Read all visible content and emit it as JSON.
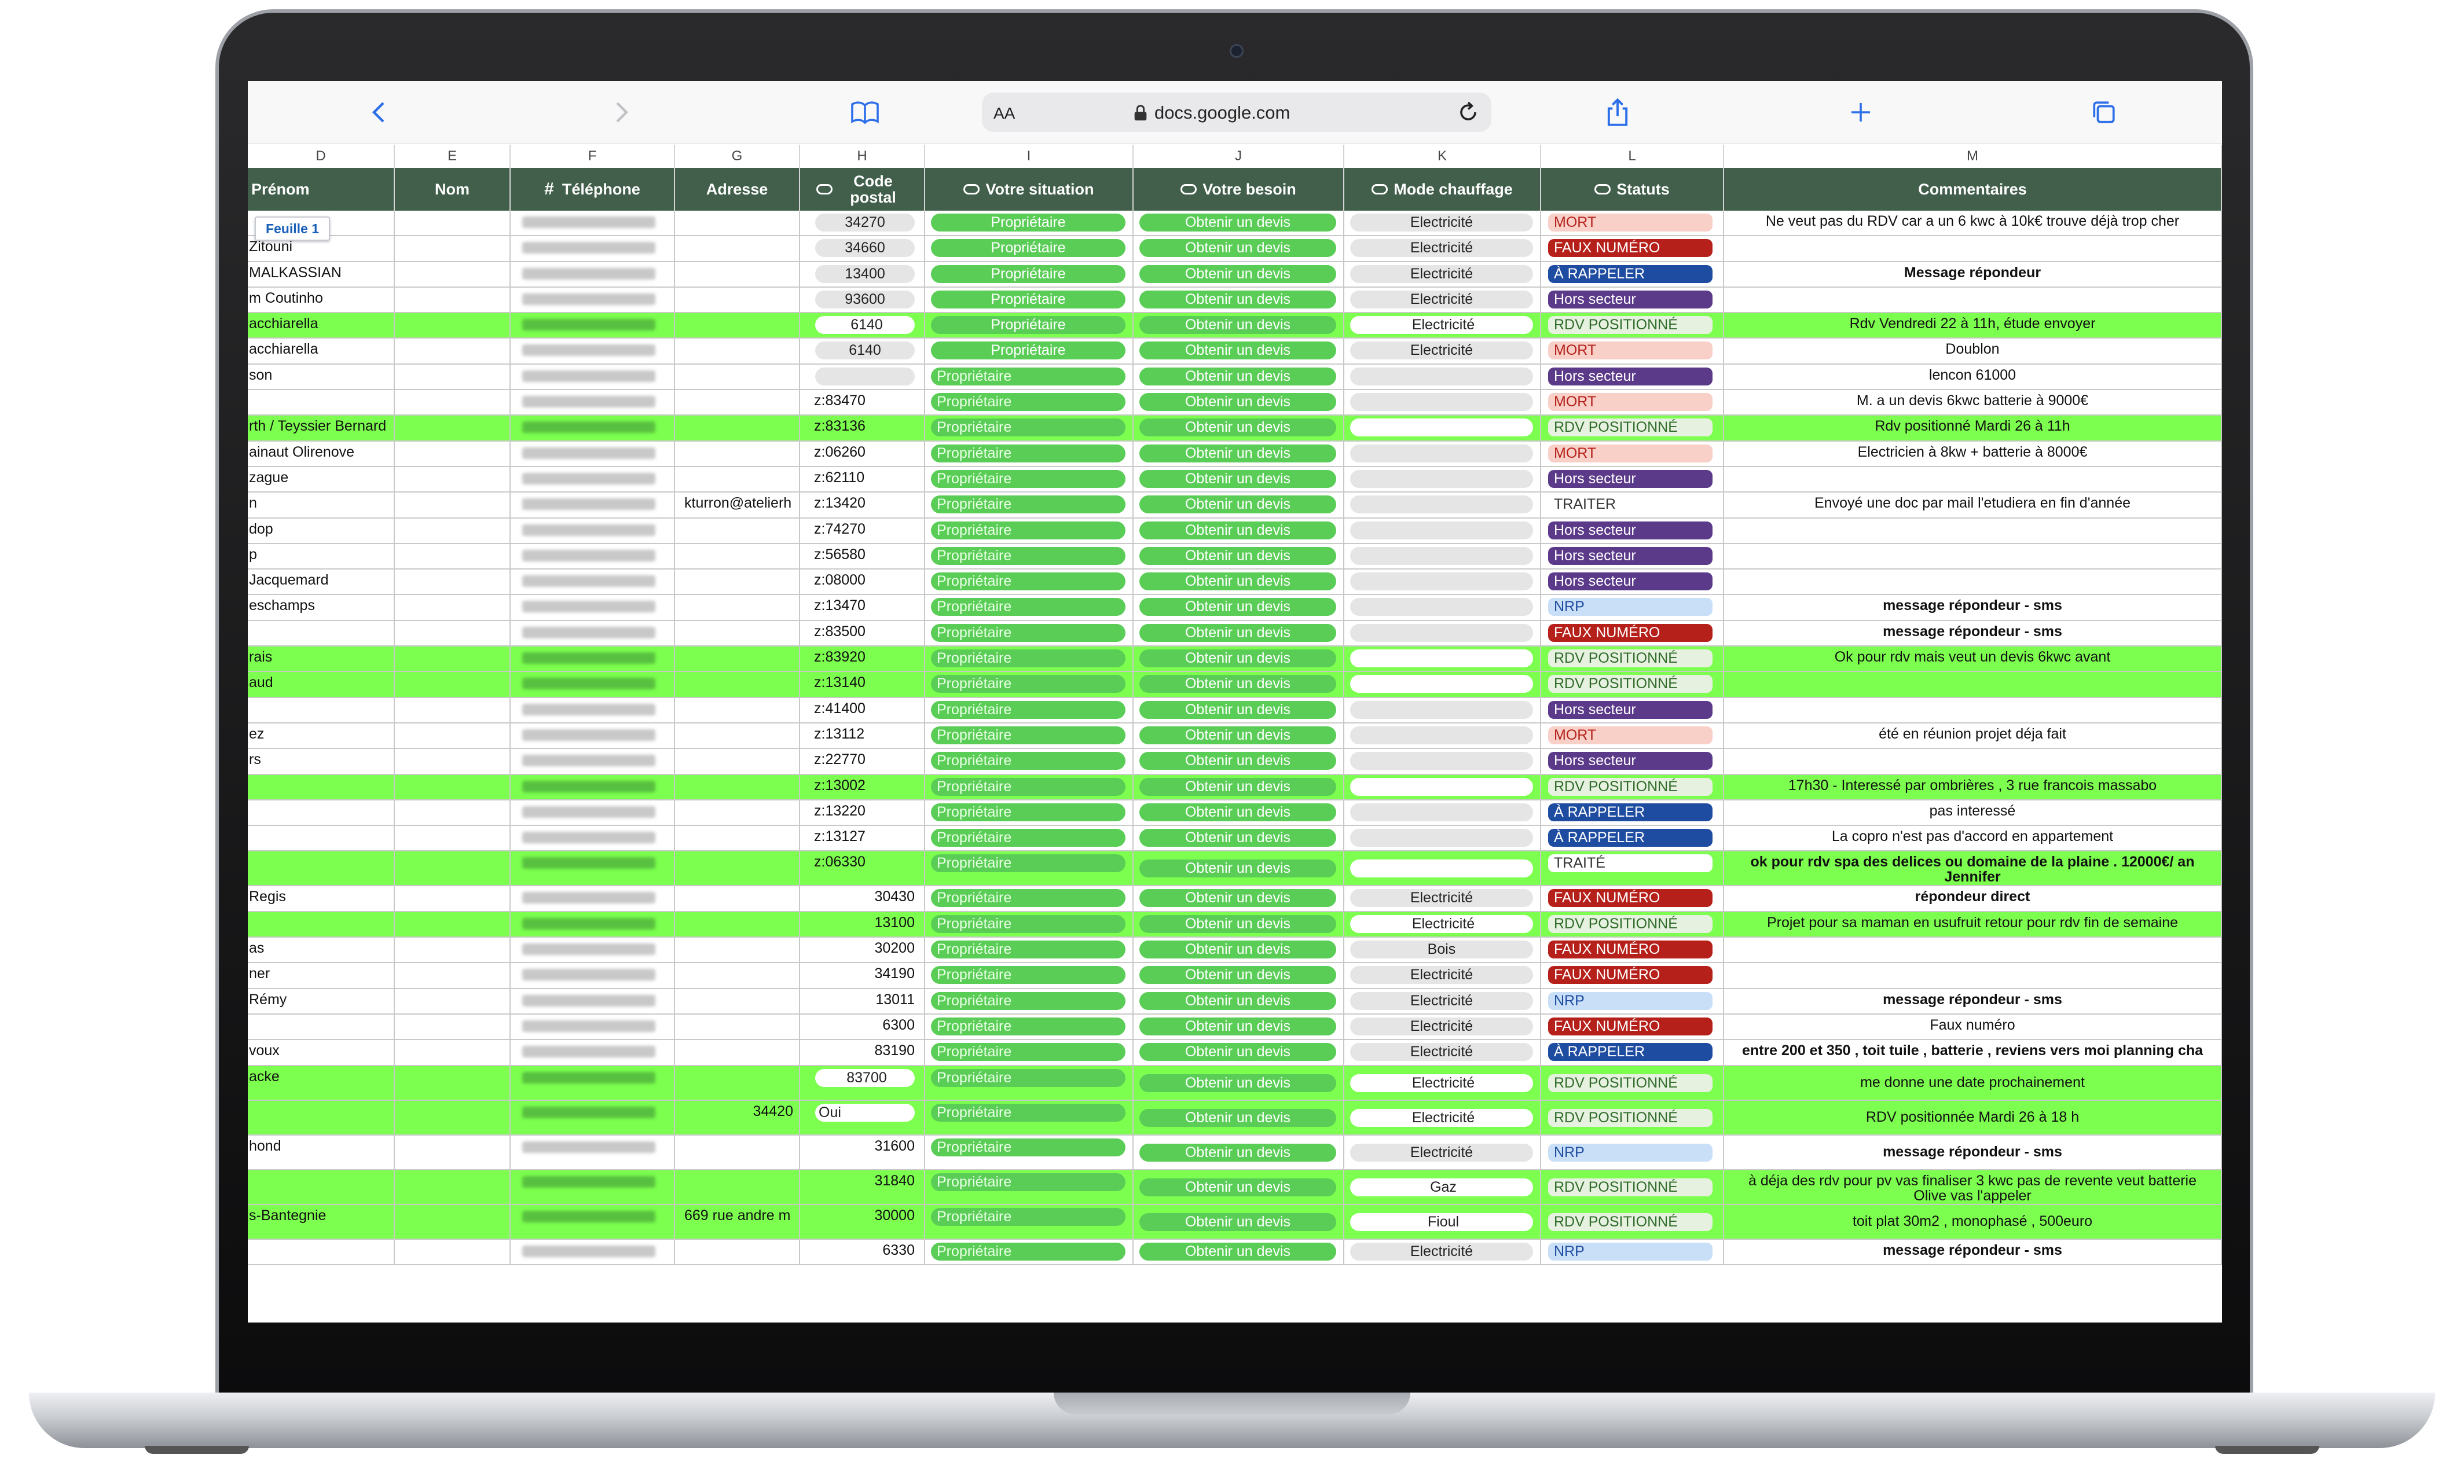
{
  "browser": {
    "text_size": "AA",
    "url": "docs.google.com"
  },
  "column_letters": [
    "D",
    "E",
    "F",
    "G",
    "H",
    "I",
    "J",
    "K",
    "L",
    "M"
  ],
  "headers": [
    "Prénom",
    "Nom",
    "Téléphone",
    "Adresse",
    "Code postal",
    "Votre situation",
    "Votre besoin",
    "Mode chauffage",
    "Statuts",
    "Commentaires"
  ],
  "sheet_tab": "Feuille 1",
  "colors": {
    "header_bg": "#415f4a",
    "row_highlight": "#7cff4e",
    "mort": "#f8d0c8",
    "faux": "#b5201a",
    "rappeler": "#1e4ca0",
    "hors": "#5c3a8a",
    "rdv": "#e6f1df",
    "nrp": "#c9dff7"
  },
  "rows": [
    {
      "prenom": "",
      "adresse": "",
      "cp": "34270",
      "cp_style": "gray",
      "sit": "Propriétaire",
      "sit_style": "light",
      "besoin": "Obtenir un devis",
      "chauff": "Electricité",
      "statut": "MORT",
      "comment": "Ne veut pas du RDV car a un 6 kwc à 10k€ trouve déjà trop cher",
      "bold": false,
      "green": false,
      "h": 2
    },
    {
      "prenom": "Zitouni",
      "adresse": "",
      "cp": "34660",
      "cp_style": "gray",
      "sit": "Propriétaire",
      "sit_style": "light",
      "besoin": "Obtenir un devis",
      "chauff": "Electricité",
      "statut": "FAUX NUMÉRO",
      "comment": "",
      "bold": false,
      "green": false,
      "h": 2
    },
    {
      "prenom": "MALKASSIAN",
      "adresse": "",
      "cp": "13400",
      "cp_style": "gray",
      "sit": "Propriétaire",
      "sit_style": "light",
      "besoin": "Obtenir un devis",
      "chauff": "Electricité",
      "statut": "À RAPPELER",
      "comment": "Message répondeur",
      "bold": true,
      "green": false,
      "h": 2
    },
    {
      "prenom": "m Coutinho",
      "adresse": "",
      "cp": "93600",
      "cp_style": "gray",
      "sit": "Propriétaire",
      "sit_style": "light",
      "besoin": "Obtenir un devis",
      "chauff": "Electricité",
      "statut": "Hors secteur",
      "comment": "",
      "bold": false,
      "green": false,
      "h": 2
    },
    {
      "prenom": "acchiarella",
      "adresse": "",
      "cp": "6140",
      "cp_style": "white",
      "sit": "Propriétaire",
      "sit_style": "light",
      "besoin": "Obtenir un devis",
      "chauff": "Electricité",
      "statut": "RDV POSITIONNÉ",
      "comment": "Rdv Vendredi 22 à 11h, étude envoyer",
      "bold": false,
      "green": true,
      "h": 2
    },
    {
      "prenom": "acchiarella",
      "adresse": "",
      "cp": "6140",
      "cp_style": "gray",
      "sit": "Propriétaire",
      "sit_style": "light",
      "besoin": "Obtenir un devis",
      "chauff": "Electricité",
      "statut": "MORT",
      "comment": "Doublon",
      "bold": false,
      "green": false,
      "h": 2
    },
    {
      "prenom": "son",
      "adresse": "",
      "cp": "",
      "cp_style": "gray",
      "sit": "Propriétaire",
      "sit_style": "left",
      "besoin": "Obtenir un devis",
      "chauff": "",
      "statut": "Hors secteur",
      "comment": "lencon 61000",
      "bold": false,
      "green": false,
      "h": 2
    },
    {
      "prenom": "",
      "adresse": "",
      "cp": "z:83470",
      "cp_style": "text",
      "sit": "Propriétaire",
      "sit_style": "left",
      "besoin": "Obtenir un devis",
      "chauff": "",
      "statut": "MORT",
      "comment": "M. a un devis 6kwc batterie à 9000€",
      "bold": false,
      "green": false,
      "h": 2
    },
    {
      "prenom": "rth / Teyssier Bernard",
      "adresse": "",
      "cp": "z:83136",
      "cp_style": "text",
      "sit": "Propriétaire",
      "sit_style": "left",
      "besoin": "Obtenir un devis",
      "chauff": "",
      "statut": "RDV POSITIONNÉ",
      "comment": "Rdv positionné Mardi 26 à 11h",
      "bold": false,
      "green": true,
      "h": 2
    },
    {
      "prenom": "ainaut Olirenove",
      "adresse": "",
      "cp": "z:06260",
      "cp_style": "text",
      "sit": "Propriétaire",
      "sit_style": "left",
      "besoin": "Obtenir un devis",
      "chauff": "",
      "statut": "MORT",
      "comment": "Electricien à 8kw + batterie à 8000€",
      "bold": false,
      "green": false,
      "h": 2
    },
    {
      "prenom": "zague",
      "adresse": "",
      "cp": "z:62110",
      "cp_style": "text",
      "sit": "Propriétaire",
      "sit_style": "left",
      "besoin": "Obtenir un devis",
      "chauff": "",
      "statut": "Hors secteur",
      "comment": "",
      "bold": false,
      "green": false,
      "h": 2
    },
    {
      "prenom": "n",
      "adresse": "kturron@atelierh",
      "cp": "z:13420",
      "cp_style": "text",
      "sit": "Propriétaire",
      "sit_style": "left",
      "besoin": "Obtenir un devis",
      "chauff": "",
      "statut": "TRAITER",
      "comment": "Envoyé une doc par mail l'etudiera en fin d'année",
      "bold": false,
      "green": false,
      "h": 2
    },
    {
      "prenom": "dop",
      "adresse": "",
      "cp": "z:74270",
      "cp_style": "text",
      "sit": "Propriétaire",
      "sit_style": "left",
      "besoin": "Obtenir un devis",
      "chauff": "",
      "statut": "Hors secteur",
      "comment": "",
      "bold": false,
      "green": false,
      "h": 2
    },
    {
      "prenom": "p",
      "adresse": "",
      "cp": "z:56580",
      "cp_style": "text",
      "sit": "Propriétaire",
      "sit_style": "left",
      "besoin": "Obtenir un devis",
      "chauff": "",
      "statut": "Hors secteur",
      "comment": "",
      "bold": false,
      "green": false,
      "h": 2
    },
    {
      "prenom": "Jacquemard",
      "adresse": "",
      "cp": "z:08000",
      "cp_style": "text",
      "sit": "Propriétaire",
      "sit_style": "left",
      "besoin": "Obtenir un devis",
      "chauff": "",
      "statut": "Hors secteur",
      "comment": "",
      "bold": false,
      "green": false,
      "h": 2
    },
    {
      "prenom": "eschamps",
      "adresse": "",
      "cp": "z:13470",
      "cp_style": "text",
      "sit": "Propriétaire",
      "sit_style": "left",
      "besoin": "Obtenir un devis",
      "chauff": "",
      "statut": "NRP",
      "comment": "message répondeur - sms",
      "bold": true,
      "green": false,
      "h": 2
    },
    {
      "prenom": "",
      "adresse": "",
      "cp": "z:83500",
      "cp_style": "text",
      "sit": "Propriétaire",
      "sit_style": "left",
      "besoin": "Obtenir un devis",
      "chauff": "",
      "statut": "FAUX NUMÉRO",
      "comment": "message répondeur - sms",
      "bold": true,
      "green": false,
      "h": 2
    },
    {
      "prenom": "rais",
      "adresse": "",
      "cp": "z:83920",
      "cp_style": "text",
      "sit": "Propriétaire",
      "sit_style": "left",
      "besoin": "Obtenir un devis",
      "chauff": "",
      "statut": "RDV POSITIONNÉ",
      "comment": "Ok pour rdv mais veut un devis 6kwc avant",
      "bold": false,
      "green": true,
      "h": 2
    },
    {
      "prenom": "aud",
      "adresse": "",
      "cp": "z:13140",
      "cp_style": "text",
      "sit": "Propriétaire",
      "sit_style": "left",
      "besoin": "Obtenir un devis",
      "chauff": "",
      "statut": "RDV POSITIONNÉ",
      "comment": "",
      "bold": false,
      "green": true,
      "h": 2
    },
    {
      "prenom": "",
      "adresse": "",
      "cp": "z:41400",
      "cp_style": "text",
      "sit": "Propriétaire",
      "sit_style": "left",
      "besoin": "Obtenir un devis",
      "chauff": "",
      "statut": "Hors secteur",
      "comment": "",
      "bold": false,
      "green": false,
      "h": 2
    },
    {
      "prenom": "ez",
      "adresse": "",
      "cp": "z:13112",
      "cp_style": "text",
      "sit": "Propriétaire",
      "sit_style": "left",
      "besoin": "Obtenir un devis",
      "chauff": "",
      "statut": "MORT",
      "comment": "été en réunion projet déja fait",
      "bold": false,
      "green": false,
      "h": 2
    },
    {
      "prenom": "rs",
      "adresse": "",
      "cp": "z:22770",
      "cp_style": "text",
      "sit": "Propriétaire",
      "sit_style": "left",
      "besoin": "Obtenir un devis",
      "chauff": "",
      "statut": "Hors secteur",
      "comment": "",
      "bold": false,
      "green": false,
      "h": 2
    },
    {
      "prenom": "",
      "adresse": "",
      "cp": "z:13002",
      "cp_style": "text",
      "sit": "Propriétaire",
      "sit_style": "left",
      "besoin": "Obtenir un devis",
      "chauff": "",
      "statut": "RDV POSITIONNÉ",
      "comment": "17h30 - Interessé par ombrières , 3 rue francois massabo",
      "bold": false,
      "green": true,
      "h": 2
    },
    {
      "prenom": "",
      "adresse": "",
      "cp": "z:13220",
      "cp_style": "text",
      "sit": "Propriétaire",
      "sit_style": "left",
      "besoin": "Obtenir un devis",
      "chauff": "",
      "statut": "À RAPPELER",
      "comment": "pas interessé",
      "bold": false,
      "green": false,
      "h": 2
    },
    {
      "prenom": "",
      "adresse": "",
      "cp": "z:13127",
      "cp_style": "text",
      "sit": "Propriétaire",
      "sit_style": "left",
      "besoin": "Obtenir un devis",
      "chauff": "",
      "statut": "À RAPPELER",
      "comment": "La copro n'est pas d'accord en appartement",
      "bold": false,
      "green": false,
      "h": 2
    },
    {
      "prenom": "",
      "adresse": "",
      "cp": "z:06330",
      "cp_style": "text",
      "sit": "Propriétaire",
      "sit_style": "left",
      "besoin": "Obtenir un devis",
      "chauff": "",
      "statut": "TRAITÉ",
      "comment": "ok pour rdv spa des delices ou domaine de la plaine . 12000€/ an",
      "comment2": "Jennifer",
      "bold": true,
      "green": true,
      "h": 3
    },
    {
      "prenom": "Regis",
      "adresse": "",
      "cp": "30430",
      "cp_style": "num",
      "sit": "Propriétaire",
      "sit_style": "left",
      "besoin": "Obtenir un devis",
      "chauff": "Electricité",
      "statut": "FAUX NUMÉRO",
      "comment": "répondeur direct",
      "bold": true,
      "green": false,
      "h": 2
    },
    {
      "prenom": "",
      "adresse": "",
      "cp": "13100",
      "cp_style": "num",
      "sit": "Propriétaire",
      "sit_style": "left",
      "besoin": "Obtenir un devis",
      "chauff": "Electricité",
      "statut": "RDV POSITIONNÉ",
      "comment": "Projet pour sa maman en usufruit retour pour rdv fin de semaine",
      "bold": false,
      "green": true,
      "h": 2
    },
    {
      "prenom": "as",
      "adresse": "",
      "cp": "30200",
      "cp_style": "num",
      "sit": "Propriétaire",
      "sit_style": "left",
      "besoin": "Obtenir un devis",
      "chauff": "Bois",
      "statut": "FAUX NUMÉRO",
      "comment": "",
      "bold": false,
      "green": false,
      "h": 2
    },
    {
      "prenom": "ner",
      "adresse": "",
      "cp": "34190",
      "cp_style": "num",
      "sit": "Propriétaire",
      "sit_style": "left",
      "besoin": "Obtenir un devis",
      "chauff": "Electricité",
      "statut": "FAUX NUMÉRO",
      "comment": "",
      "bold": false,
      "green": false,
      "h": 2
    },
    {
      "prenom": "Rémy",
      "adresse": "",
      "cp": "13011",
      "cp_style": "num",
      "sit": "Propriétaire",
      "sit_style": "left",
      "besoin": "Obtenir un devis",
      "chauff": "Electricité",
      "statut": "NRP",
      "comment": "message répondeur - sms",
      "bold": true,
      "green": false,
      "h": 2
    },
    {
      "prenom": "",
      "adresse": "",
      "cp": "6300",
      "cp_style": "num",
      "sit": "Propriétaire",
      "sit_style": "left",
      "besoin": "Obtenir un devis",
      "chauff": "Electricité",
      "statut": "FAUX NUMÉRO",
      "comment": "Faux numéro",
      "bold": false,
      "green": false,
      "h": 2
    },
    {
      "prenom": "voux",
      "adresse": "",
      "cp": "83190",
      "cp_style": "num",
      "sit": "Propriétaire",
      "sit_style": "left",
      "besoin": "Obtenir un devis",
      "chauff": "Electricité",
      "statut": "À RAPPELER",
      "comment": "entre 200 et 350 , toit tuile , batterie , reviens vers moi planning cha",
      "bold": true,
      "green": false,
      "h": 2
    },
    {
      "prenom": "acke",
      "adresse": "",
      "cp": "83700",
      "cp_style": "white",
      "sit": "Propriétaire",
      "sit_style": "left",
      "besoin": "Obtenir un devis",
      "chauff": "Electricité",
      "statut": "RDV POSITIONNÉ",
      "comment": "me donne une date prochainement",
      "bold": false,
      "green": true,
      "h": 3
    },
    {
      "prenom": "",
      "adresse": "34420",
      "cp": "Oui",
      "cp_style": "whiteleft",
      "sit": "Propriétaire",
      "sit_style": "left",
      "besoin": "Obtenir un devis",
      "chauff": "Electricité",
      "statut": "RDV POSITIONNÉ",
      "comment": "RDV positionnée Mardi 26 à 18 h",
      "bold": false,
      "green": true,
      "h": 3
    },
    {
      "prenom": "hond",
      "adresse": "",
      "cp": "31600",
      "cp_style": "num",
      "sit": "Propriétaire",
      "sit_style": "left",
      "besoin": "Obtenir un devis",
      "chauff": "Electricité",
      "statut": "NRP",
      "comment": "message répondeur - sms",
      "bold": true,
      "green": false,
      "h": 3
    },
    {
      "prenom": "",
      "adresse": "",
      "cp": "31840",
      "cp_style": "num",
      "sit": "Propriétaire",
      "sit_style": "left",
      "besoin": "Obtenir un devis",
      "chauff": "Gaz",
      "statut": "RDV POSITIONNÉ",
      "comment": "à déja des rdv pour pv vas finaliser 3 kwc pas de revente veut batterie",
      "comment2": "Olive vas l'appeler",
      "bold": false,
      "green": true,
      "h": 3
    },
    {
      "prenom": "s-Bantegnie",
      "adresse": "669 rue andre m",
      "cp": "30000",
      "cp_style": "num",
      "sit": "Propriétaire",
      "sit_style": "left",
      "besoin": "Obtenir un devis",
      "chauff": "Fioul",
      "statut": "RDV POSITIONNÉ",
      "comment": "toit plat 30m2 , monophasé , 500euro",
      "bold": false,
      "green": true,
      "h": 3
    },
    {
      "prenom": "",
      "adresse": "",
      "cp": "6330",
      "cp_style": "num",
      "sit": "Propriétaire",
      "sit_style": "left",
      "besoin": "Obtenir un devis",
      "chauff": "Electricité",
      "statut": "NRP",
      "comment": "message répondeur - sms",
      "bold": true,
      "green": false,
      "h": 2
    }
  ]
}
